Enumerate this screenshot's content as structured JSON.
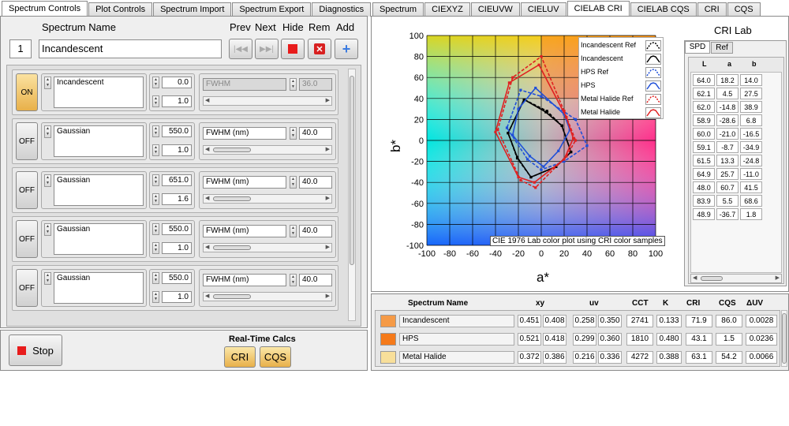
{
  "left_tabs": [
    "Spectrum Controls",
    "Plot Controls",
    "Spectrum Import",
    "Spectrum Export",
    "Diagnostics"
  ],
  "right_tabs": [
    "Spectrum",
    "CIEXYZ",
    "CIEUVW",
    "CIELUV",
    "CIELAB CRI",
    "CIELAB CQS",
    "CRI",
    "CQS"
  ],
  "header": {
    "spectrum_name_label": "Spectrum Name",
    "prev": "Prev",
    "next": "Next",
    "hide": "Hide",
    "rem": "Rem",
    "add": "Add",
    "index": "1",
    "spectrum_name": "Incandescent"
  },
  "rows": [
    {
      "state": "ON",
      "type": "Incandescent",
      "v1": "0.0",
      "v2": "1.0",
      "width_label": "FWHM",
      "width": "36.0",
      "disabled": true
    },
    {
      "state": "OFF",
      "type": "Gaussian",
      "v1": "550.0",
      "v2": "1.0",
      "width_label": "FWHM (nm)",
      "width": "40.0",
      "disabled": false
    },
    {
      "state": "OFF",
      "type": "Gaussian",
      "v1": "651.0",
      "v2": "1.6",
      "width_label": "FWHM (nm)",
      "width": "40.0",
      "disabled": false
    },
    {
      "state": "OFF",
      "type": "Gaussian",
      "v1": "550.0",
      "v2": "1.0",
      "width_label": "FWHM (nm)",
      "width": "40.0",
      "disabled": false
    },
    {
      "state": "OFF",
      "type": "Gaussian",
      "v1": "550.0",
      "v2": "1.0",
      "width_label": "FWHM (nm)",
      "width": "40.0",
      "disabled": false
    }
  ],
  "bottom": {
    "stop": "Stop",
    "realtime_label": "Real-Time Calcs",
    "cri": "CRI",
    "cqs": "CQS"
  },
  "plot": {
    "xlabel": "a*",
    "ylabel": "b*",
    "annotation": "CIE 1976 Lab color plot using CRI color samples",
    "legend": [
      "Incandescent Ref",
      "Incandescent",
      "HPS Ref",
      "HPS",
      "Metal Halide Ref",
      "Metal Halide"
    ],
    "legend_colors": [
      "#000000",
      "#000000",
      "#1f4fd8",
      "#1f4fd8",
      "#e02020",
      "#e02020"
    ]
  },
  "chart_data": {
    "type": "scatter",
    "xlabel": "a*",
    "ylabel": "b*",
    "xlim": [
      -100,
      100
    ],
    "ylim": [
      -100,
      100
    ],
    "xticks": [
      -100,
      -80,
      -60,
      -40,
      -20,
      0,
      20,
      40,
      60,
      80,
      100
    ],
    "yticks": [
      -100,
      -80,
      -60,
      -40,
      -20,
      0,
      20,
      40,
      60,
      80,
      100
    ],
    "grid": true,
    "legend_placement": "top-right",
    "series": [
      {
        "name": "Incandescent Ref",
        "color": "#000000",
        "dashed": true,
        "points": [
          [
            18,
            14
          ],
          [
            5,
            28
          ],
          [
            -15,
            39
          ],
          [
            -29,
            7
          ],
          [
            -21,
            -17
          ],
          [
            -9,
            -35
          ],
          [
            13,
            -25
          ],
          [
            26,
            -11
          ],
          [
            18,
            14
          ]
        ]
      },
      {
        "name": "Incandescent",
        "color": "#000000",
        "dashed": false,
        "points": [
          [
            18,
            14
          ],
          [
            4,
            27
          ],
          [
            -15,
            39
          ],
          [
            -29,
            7
          ],
          [
            -21,
            -16
          ],
          [
            -9,
            -35
          ],
          [
            13,
            -25
          ],
          [
            26,
            -11
          ],
          [
            18,
            14
          ]
        ]
      },
      {
        "name": "HPS Ref",
        "color": "#1f4fd8",
        "dashed": true,
        "points": [
          [
            30,
            20
          ],
          [
            0,
            42
          ],
          [
            -18,
            48
          ],
          [
            -30,
            12
          ],
          [
            -12,
            -18
          ],
          [
            0,
            -28
          ],
          [
            20,
            -20
          ],
          [
            40,
            -5
          ],
          [
            30,
            20
          ]
        ]
      },
      {
        "name": "HPS",
        "color": "#1f4fd8",
        "dashed": false,
        "points": [
          [
            20,
            25
          ],
          [
            -5,
            50
          ],
          [
            -20,
            30
          ],
          [
            -25,
            5
          ],
          [
            -10,
            -15
          ],
          [
            2,
            -25
          ],
          [
            15,
            -10
          ],
          [
            25,
            10
          ],
          [
            20,
            25
          ]
        ]
      },
      {
        "name": "Metal Halide Ref",
        "color": "#e02020",
        "dashed": true,
        "points": [
          [
            20,
            28
          ],
          [
            0,
            80
          ],
          [
            -25,
            60
          ],
          [
            -38,
            10
          ],
          [
            -18,
            -38
          ],
          [
            -5,
            -45
          ],
          [
            22,
            -15
          ],
          [
            30,
            0
          ],
          [
            20,
            28
          ]
        ]
      },
      {
        "name": "Metal Halide",
        "color": "#e02020",
        "dashed": false,
        "points": [
          [
            22,
            22
          ],
          [
            -2,
            72
          ],
          [
            -28,
            55
          ],
          [
            -40,
            8
          ],
          [
            -20,
            -35
          ],
          [
            -6,
            -40
          ],
          [
            20,
            -18
          ],
          [
            28,
            2
          ],
          [
            22,
            22
          ]
        ]
      }
    ]
  },
  "cri_lab": {
    "title": "CRI Lab",
    "tabs": [
      "SPD",
      "Ref"
    ],
    "headers": [
      "L",
      "a",
      "b"
    ],
    "rows": [
      [
        "64.0",
        "18.2",
        "14.0"
      ],
      [
        "62.1",
        "4.5",
        "27.5"
      ],
      [
        "62.0",
        "-14.8",
        "38.9"
      ],
      [
        "58.9",
        "-28.6",
        "6.8"
      ],
      [
        "60.0",
        "-21.0",
        "-16.5"
      ],
      [
        "59.1",
        "-8.7",
        "-34.9"
      ],
      [
        "61.5",
        "13.3",
        "-24.8"
      ],
      [
        "64.9",
        "25.7",
        "-11.0"
      ],
      [
        "48.0",
        "60.7",
        "41.5"
      ],
      [
        "83.9",
        "5.5",
        "68.6"
      ],
      [
        "48.9",
        "-36.7",
        "1.8"
      ]
    ]
  },
  "summary": {
    "headers": {
      "name": "Spectrum Name",
      "xy": "xy",
      "uv": "uv",
      "cct": "CCT",
      "k": "K",
      "cri": "CRI",
      "cqs": "CQS",
      "duv": "ΔUV"
    },
    "rows": [
      {
        "color": "#f59a46",
        "name": "Incandescent",
        "x": "0.451",
        "y": "0.408",
        "u": "0.258",
        "v": "0.350",
        "cct": "2741",
        "k": "0.133",
        "cri": "71.9",
        "cqs": "86.0",
        "duv": "0.0028"
      },
      {
        "color": "#f57a1a",
        "name": "HPS",
        "x": "0.521",
        "y": "0.418",
        "u": "0.299",
        "v": "0.360",
        "cct": "1810",
        "k": "0.480",
        "cri": "43.1",
        "cqs": "1.5",
        "duv": "0.0236"
      },
      {
        "color": "#f8df9a",
        "name": "Metal Halide",
        "x": "0.372",
        "y": "0.386",
        "u": "0.216",
        "v": "0.336",
        "cct": "4272",
        "k": "0.388",
        "cri": "63.1",
        "cqs": "54.2",
        "duv": "0.0066"
      }
    ]
  }
}
